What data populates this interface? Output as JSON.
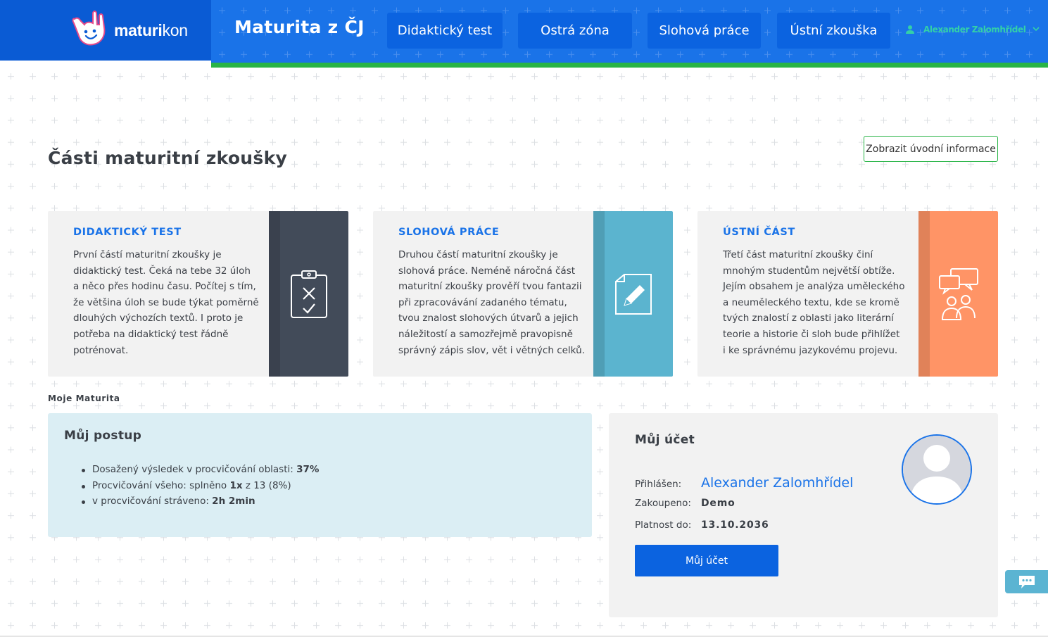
{
  "logo": {
    "text_bold": "maturi",
    "text_light": "kon"
  },
  "header": {
    "title": "Maturita z ČJ",
    "nav": [
      {
        "label": "Didaktický test"
      },
      {
        "label": "Ostrá zóna"
      },
      {
        "label": "Slohová práce"
      },
      {
        "label": "Ústní zkouška"
      }
    ],
    "user_name": "Alexander Zalomhřídel"
  },
  "main": {
    "title": "Části maturitní zkoušky",
    "intro_button": "Zobrazit úvodní informace",
    "cards": [
      {
        "title": "DIDAKTICKÝ TEST",
        "lines": [
          "První částí maturitní zkoušky je",
          "didaktický test. Čeká na tebe 32 úloh",
          "a něco přes hodinu času. Počítej s tím,",
          "že většina úloh se bude týkat poměrně",
          "dlouhých výchozích textů. I proto je",
          "potřeba na didaktický test řádně",
          "potrénovat."
        ],
        "color": "#424b59",
        "icon": "clipboard-icon"
      },
      {
        "title": "SLOHOVÁ PRÁCE",
        "lines": [
          "Druhou částí maturitní zkoušky je",
          "slohová práce. Neméně náročná část",
          "maturitní zkoušky prověří tvou fantazii",
          "při zpracovávání zadaného tématu,",
          "tvou znalost slohových útvarů a jejich",
          "náležitostí a samozřejmě pravopisně",
          "správný zápis slov, vět i větných celků."
        ],
        "color": "#5bb4cf",
        "icon": "document-pencil-icon"
      },
      {
        "title": "ÚSTNÍ ČÁST",
        "lines": [
          "Třetí část maturitní zkoušky činí",
          "mnohým studentům největší obtíže.",
          "Jejím obsahem je analýza uměleckého",
          "a neuměleckého textu, kde se kromě",
          "tvých znalostí z oblasti jako literární",
          "teorie a historie či sloh bude přihlížet",
          "i ke správnému jazykovému projevu."
        ],
        "color": "#ff9466",
        "icon": "conversation-icon"
      }
    ],
    "section_label": "Moje Maturita"
  },
  "progress": {
    "title": "Můj postup",
    "items": [
      {
        "text": "Dosažený výsledek v procvičování oblasti: ",
        "bold": "37%"
      },
      {
        "text_pre": "Procvičování všeho: splněno ",
        "bold": "1x",
        "text_post": " z 13 (8%)"
      },
      {
        "text": "v procvičování stráveno: ",
        "bold": "2h 2min"
      }
    ]
  },
  "account": {
    "title": "Můj účet",
    "logged_label": "Přihlášen:",
    "logged_value": "Alexander Zalomhřídel",
    "purchased_label": "Zakoupeno:",
    "purchased_value": "Demo",
    "valid_label": "Platnost do:",
    "valid_value": "13.10.2036",
    "button": "Můj účet"
  },
  "colors": {
    "primary": "#1a73e8",
    "header_dark": "#0a5bd4",
    "accent_green": "#28b446",
    "user_teal": "#33d0a8"
  }
}
